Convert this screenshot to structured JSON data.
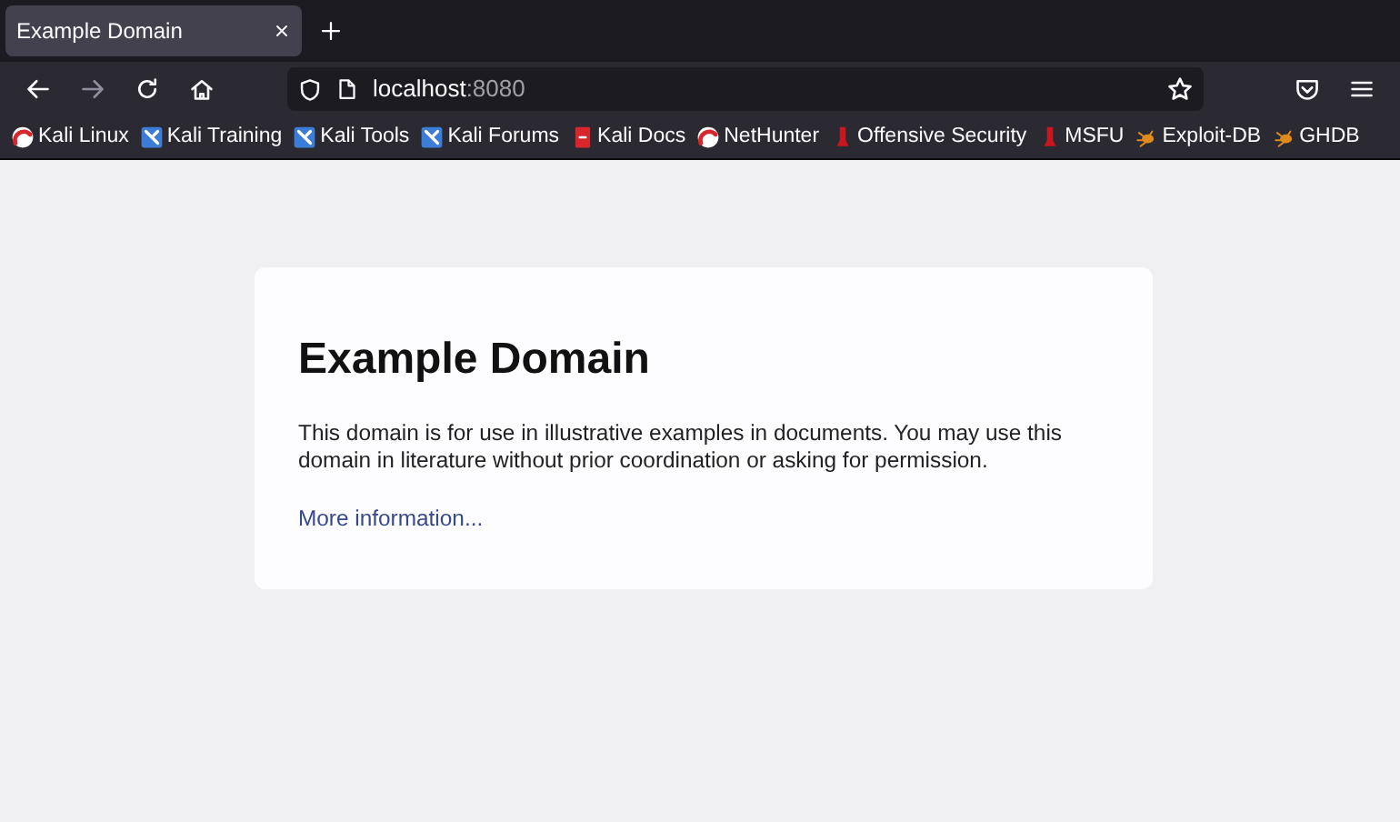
{
  "tabs": [
    {
      "title": "Example Domain",
      "selected": true
    }
  ],
  "address_bar": {
    "host": "localhost",
    "port": ":8080"
  },
  "bookmarks": [
    {
      "label": "Kali Linux",
      "kind": "kali"
    },
    {
      "label": "Kali Training",
      "kind": "blue"
    },
    {
      "label": "Kali Tools",
      "kind": "blue"
    },
    {
      "label": "Kali Forums",
      "kind": "blue"
    },
    {
      "label": "Kali Docs",
      "kind": "docs"
    },
    {
      "label": "NetHunter",
      "kind": "kali"
    },
    {
      "label": "Offensive Security",
      "kind": "offsec"
    },
    {
      "label": "MSFU",
      "kind": "offsec"
    },
    {
      "label": "Exploit-DB",
      "kind": "bug"
    },
    {
      "label": "GHDB",
      "kind": "bug"
    }
  ],
  "page": {
    "heading": "Example Domain",
    "paragraph": "This domain is for use in illustrative examples in documents. You may use this domain in literature without prior coordination or asking for permission.",
    "link": "More information..."
  }
}
